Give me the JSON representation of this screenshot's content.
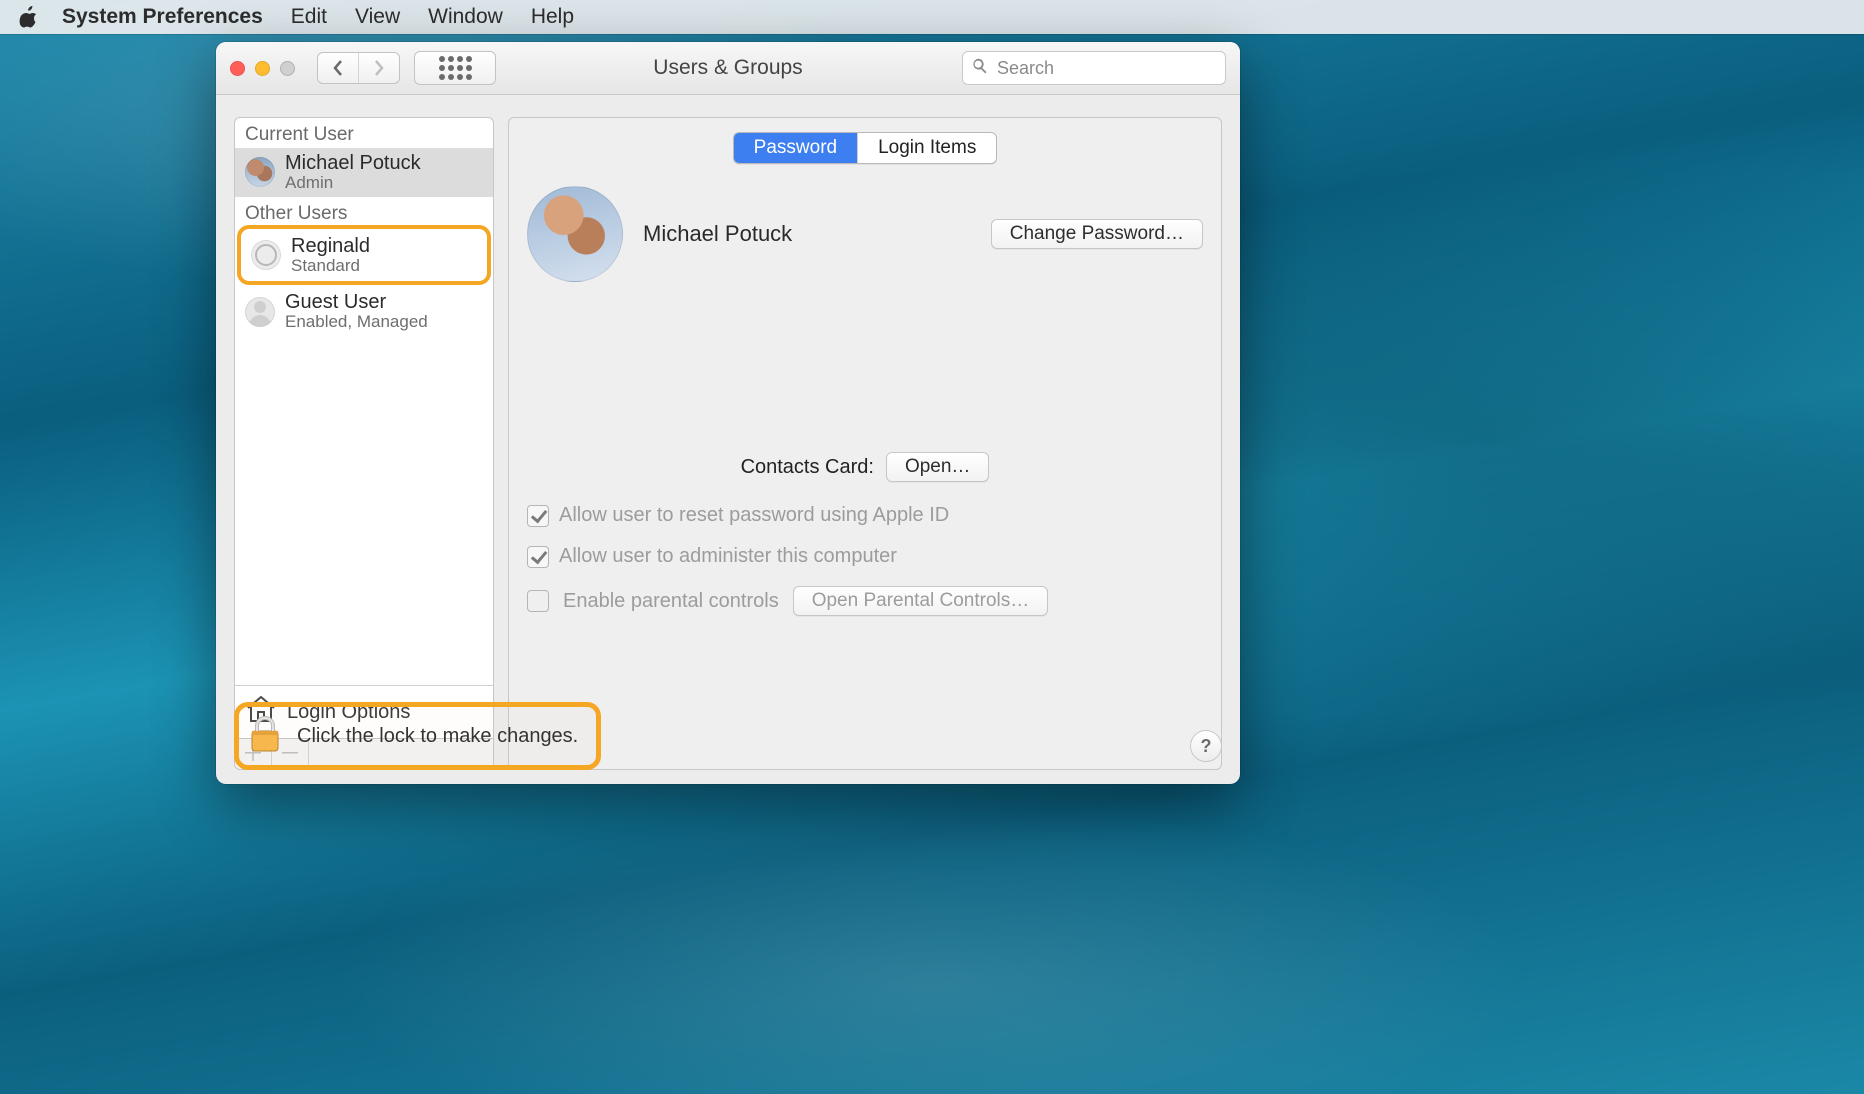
{
  "menubar": {
    "app_name": "System Preferences",
    "items": [
      "Edit",
      "View",
      "Window",
      "Help"
    ]
  },
  "window": {
    "title": "Users & Groups",
    "search_placeholder": "Search"
  },
  "sidebar": {
    "current_user_header": "Current User",
    "other_users_header": "Other Users",
    "current_user": {
      "name": "Michael Potuck",
      "role": "Admin"
    },
    "other_users": [
      {
        "name": "Reginald",
        "role": "Standard",
        "highlighted": true
      },
      {
        "name": "Guest User",
        "role": "Enabled, Managed",
        "highlighted": false
      }
    ],
    "login_options_label": "Login Options"
  },
  "tabs": {
    "password": "Password",
    "login_items": "Login Items",
    "active": "password"
  },
  "profile": {
    "display_name": "Michael Potuck",
    "change_password_label": "Change Password…"
  },
  "contacts": {
    "label": "Contacts Card:",
    "open_label": "Open…"
  },
  "options": {
    "reset_apple_id": {
      "label": "Allow user to reset password using Apple ID",
      "checked": true,
      "enabled": false
    },
    "administer": {
      "label": "Allow user to administer this computer",
      "checked": true,
      "enabled": false
    },
    "parental": {
      "label": "Enable parental controls",
      "checked": false,
      "enabled": false
    },
    "open_parental_label": "Open Parental Controls…"
  },
  "lock": {
    "text": "Click the lock to make changes."
  },
  "help_symbol": "?"
}
